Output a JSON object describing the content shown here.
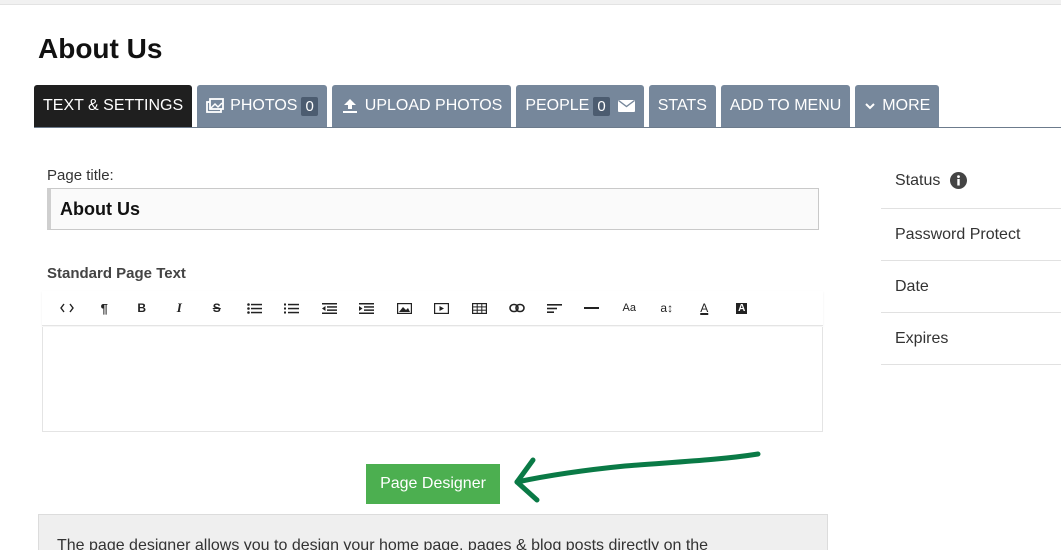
{
  "page": {
    "heading": "About Us"
  },
  "tabs": [
    {
      "label": "TEXT & SETTINGS",
      "icon": null,
      "badge": null
    },
    {
      "label": "PHOTOS",
      "icon": "photos-icon",
      "badge": "0"
    },
    {
      "label": "UPLOAD PHOTOS",
      "icon": "upload-icon",
      "badge": null
    },
    {
      "label": "PEOPLE",
      "icon": null,
      "badge": "0",
      "trailing_icon": "envelope-icon"
    },
    {
      "label": "STATS",
      "icon": null,
      "badge": null
    },
    {
      "label": "ADD TO MENU",
      "icon": null,
      "badge": null
    },
    {
      "label": "MORE",
      "icon": "chevron-down-icon",
      "badge": null
    }
  ],
  "form": {
    "title_label": "Page title:",
    "title_value": "About Us",
    "standard_text_label": "Standard Page Text"
  },
  "editor": {
    "toolbar": [
      {
        "name": "code-view",
        "glyph": "<>"
      },
      {
        "name": "paragraph",
        "glyph": "¶"
      },
      {
        "name": "bold",
        "glyph": "B"
      },
      {
        "name": "italic",
        "glyph": "I"
      },
      {
        "name": "strikethrough",
        "glyph": "S"
      },
      {
        "name": "unordered-list",
        "glyph": "ul"
      },
      {
        "name": "ordered-list",
        "glyph": "ol"
      },
      {
        "name": "outdent",
        "glyph": "out"
      },
      {
        "name": "indent",
        "glyph": "in"
      },
      {
        "name": "image",
        "glyph": "img"
      },
      {
        "name": "video",
        "glyph": "vid"
      },
      {
        "name": "table",
        "glyph": "tbl"
      },
      {
        "name": "link",
        "glyph": "lnk"
      },
      {
        "name": "align",
        "glyph": "aln"
      },
      {
        "name": "horizontal-rule",
        "glyph": "hr"
      },
      {
        "name": "font-size",
        "glyph": "Aa"
      },
      {
        "name": "line-height",
        "glyph": "a↕"
      },
      {
        "name": "font-color",
        "glyph": "A"
      },
      {
        "name": "background-color",
        "glyph": "A"
      }
    ]
  },
  "designer": {
    "button_label": "Page Designer"
  },
  "info": {
    "text": "The page designer allows you to design your home page, pages & blog posts directly on the"
  },
  "sidebar": {
    "items": [
      {
        "label": "Status",
        "icon": "info-icon"
      },
      {
        "label": "Password Protect"
      },
      {
        "label": "Date"
      },
      {
        "label": "Expires"
      }
    ]
  },
  "colors": {
    "tab_bg": "#76879b",
    "tab_active_bg": "#1f1f1f",
    "primary_button": "#4caf50",
    "annotation_arrow": "#0a7a46"
  }
}
